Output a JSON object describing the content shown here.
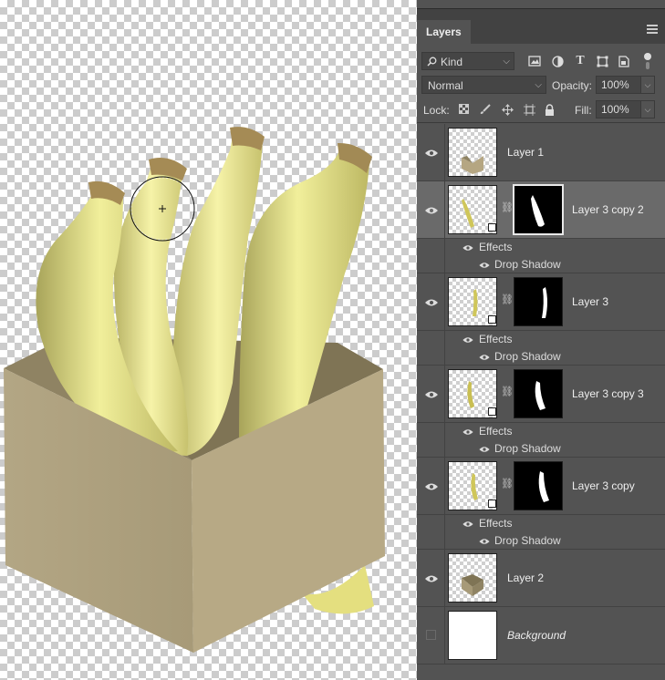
{
  "panel": {
    "tab_label": "Layers",
    "filter": {
      "kind_label": "Kind"
    },
    "blend": {
      "mode": "Normal",
      "opacity_label": "Opacity:",
      "opacity_value": "100%"
    },
    "lock": {
      "lock_label": "Lock:",
      "fill_label": "Fill:",
      "fill_value": "100%"
    },
    "layers": [
      {
        "name": "Layer 1",
        "visible": true,
        "italic": false
      },
      {
        "name": "Layer 3 copy 2",
        "visible": true,
        "selected": true,
        "effects_label": "Effects",
        "effect": "Drop Shadow"
      },
      {
        "name": "Layer 3",
        "visible": true,
        "effects_label": "Effects",
        "effect": "Drop Shadow"
      },
      {
        "name": "Layer 3 copy 3",
        "visible": true,
        "effects_label": "Effects",
        "effect": "Drop Shadow"
      },
      {
        "name": "Layer 3 copy",
        "visible": true,
        "effects_label": "Effects",
        "effect": "Drop Shadow"
      },
      {
        "name": "Layer 2",
        "visible": true
      },
      {
        "name": "Background",
        "visible": false,
        "italic": true
      }
    ]
  },
  "colors": {
    "panel_bg": "#535353",
    "selected_row": "#6a6a6a",
    "box": "#b7a985",
    "banana": "#e6e08a"
  }
}
